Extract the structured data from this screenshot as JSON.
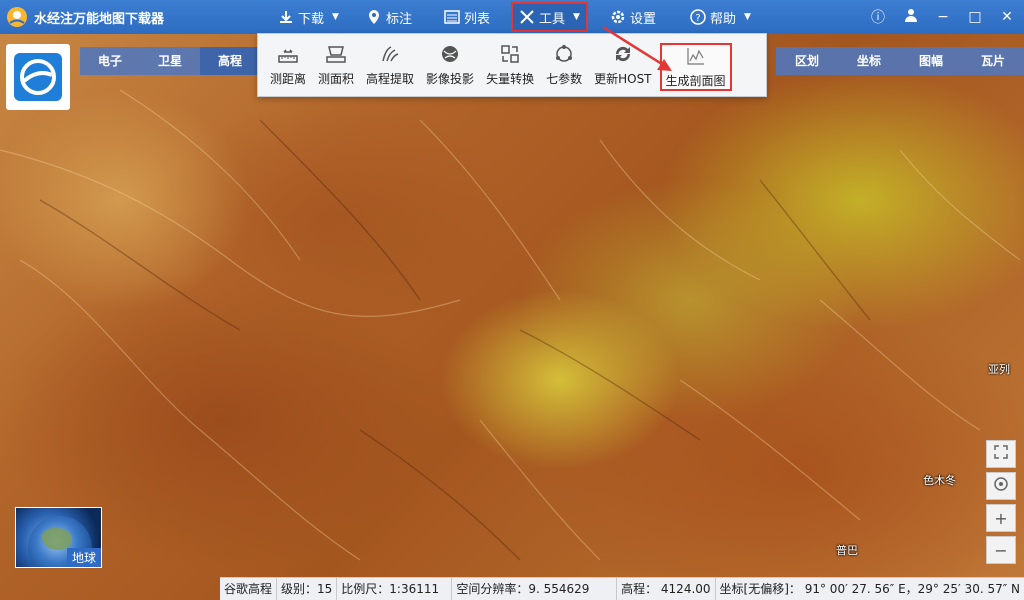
{
  "app": {
    "title": "水经注万能地图下载器"
  },
  "menus": [
    {
      "label": "下载",
      "icon": "download-icon",
      "caret": "▼"
    },
    {
      "label": "标注",
      "icon": "location-pin-icon"
    },
    {
      "label": "列表",
      "icon": "list-icon"
    },
    {
      "label": "工具",
      "icon": "tools-icon",
      "caret": "▼",
      "active": true
    },
    {
      "label": "设置",
      "icon": "gear-icon"
    },
    {
      "label": "帮助",
      "icon": "help-icon",
      "caret": "▼"
    }
  ],
  "window_controls": {
    "info": "ⓘ",
    "user": "user-icon",
    "minimize": "−",
    "maximize": "□",
    "close": "✕"
  },
  "map_types_left": [
    "电子",
    "卫星",
    "高程"
  ],
  "map_types_left_active": "高程",
  "map_types_right": [
    "区划",
    "坐标",
    "图幅",
    "瓦片"
  ],
  "tools": [
    {
      "label": "测距离",
      "icon": "ruler-icon"
    },
    {
      "label": "测面积",
      "icon": "area-measure-icon"
    },
    {
      "label": "高程提取",
      "icon": "elevation-extract-icon"
    },
    {
      "label": "影像投影",
      "icon": "projection-icon"
    },
    {
      "label": "矢量转换",
      "icon": "vector-convert-icon"
    },
    {
      "label": "七参数",
      "icon": "seven-params-icon"
    },
    {
      "label": "更新HOST",
      "icon": "refresh-icon"
    },
    {
      "label": "生成剖面图",
      "icon": "profile-chart-icon",
      "highlighted": true
    }
  ],
  "places": [
    "亚列",
    "色木冬",
    "普巴"
  ],
  "globe": {
    "label": "地球"
  },
  "map_controls": {
    "fullscreen": "fullscreen-icon",
    "locate": "locate-icon",
    "zoom_in": "+",
    "zoom_out": "−"
  },
  "status": {
    "source": "谷歌高程",
    "level": "级别：15",
    "scale": "比例尺：1:36111",
    "resolution": "空间分辨率：9. 554629",
    "elevation": "高程：  4124.00",
    "coords": "坐标[无偏移]：  91° 00′ 27. 56″ E，29° 25′ 30. 57″ N"
  },
  "colors": {
    "accent": "#2c6cc2",
    "highlight": "#e53535"
  }
}
